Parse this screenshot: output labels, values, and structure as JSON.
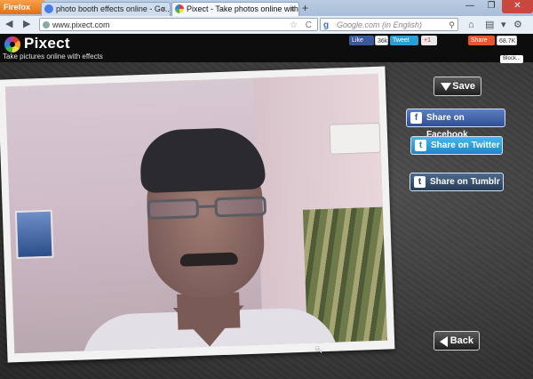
{
  "browser": {
    "app_button": "Firefox",
    "tabs": [
      {
        "title": "photo booth effects online - Go...",
        "close": "×"
      },
      {
        "title": "Pixect - Take photos online with...",
        "close": "×"
      }
    ],
    "new_tab": "+",
    "url": "www.pixect.com",
    "search_placeholder": "Google.com (in English)",
    "search_engine_letter": "g",
    "window_controls": {
      "minimize": "—",
      "maximize": "❐",
      "close": "✕"
    },
    "nav": {
      "back": "◀",
      "forward": "▶",
      "reload": "C",
      "bookmark_star": "☆"
    }
  },
  "site": {
    "logo_text": "Pixect",
    "tagline": "Take pictures online with effects",
    "social": {
      "fb_like": "Like",
      "fb_count": "36k",
      "tweet": "Tweet",
      "gplus": "+1",
      "share": "Share",
      "share_count": "68.7K"
    },
    "block_label": "Block..."
  },
  "actions": {
    "save": "Save",
    "share_facebook": "Share on Facebook",
    "share_twitter": "Share on Twitter",
    "share_tumblr": "Share on Tumblr",
    "back": "Back"
  },
  "icons": {
    "facebook": "f",
    "twitter": "t",
    "tumblr": "t"
  },
  "colors": {
    "facebook": "#3b5998",
    "twitter": "#1b86c8",
    "tumblr": "#263c57",
    "firefox_orange": "#e46f10"
  }
}
